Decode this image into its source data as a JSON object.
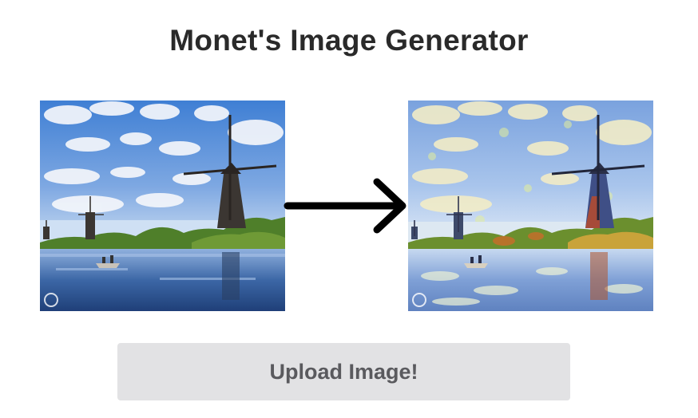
{
  "header": {
    "title": "Monet's Image Generator"
  },
  "images": {
    "original": {
      "icon": "landscape-photo-windmills"
    },
    "stylized": {
      "icon": "monet-style-painting-windmills"
    },
    "arrow": {
      "icon": "right-arrow-icon"
    }
  },
  "actions": {
    "upload_label": "Upload Image!"
  },
  "colors": {
    "sky": "#5b8fd6",
    "cloud": "#f4f6fb",
    "water": "#3f6fae",
    "grass": "#5d8f2f",
    "mill": "#3b3632",
    "button_bg": "#e2e2e4",
    "button_text": "#5a5a5e",
    "arrow": "#000000"
  }
}
